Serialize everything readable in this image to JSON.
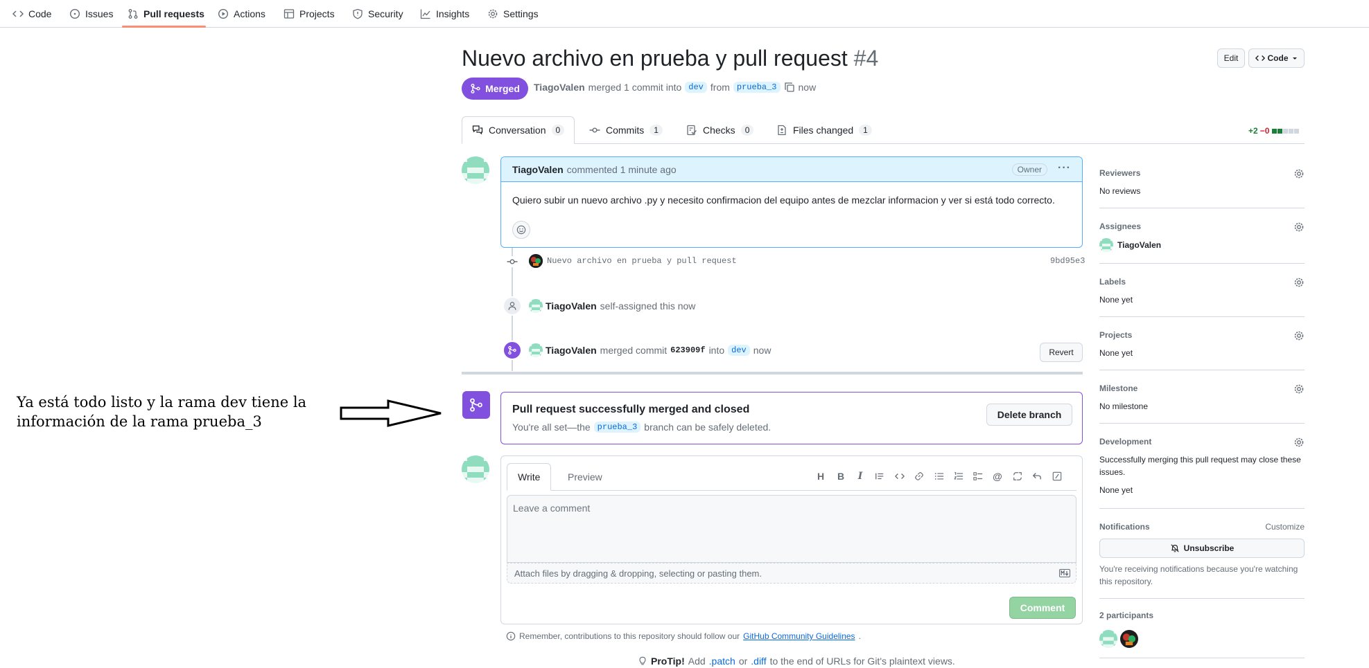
{
  "nav": {
    "items": [
      {
        "label": "Code",
        "icon": "code-icon"
      },
      {
        "label": "Issues",
        "icon": "issue-icon"
      },
      {
        "label": "Pull requests",
        "icon": "pull-request-icon"
      },
      {
        "label": "Actions",
        "icon": "play-icon"
      },
      {
        "label": "Projects",
        "icon": "table-icon"
      },
      {
        "label": "Security",
        "icon": "shield-icon"
      },
      {
        "label": "Insights",
        "icon": "graph-icon"
      },
      {
        "label": "Settings",
        "icon": "gear-icon"
      }
    ],
    "active": "Pull requests"
  },
  "pr": {
    "title": "Nuevo archivo en prueba y pull request",
    "number": "#4",
    "status": "Merged",
    "author": "TiagoValen",
    "merged_text": "merged 1 commit into",
    "base_branch": "dev",
    "from_text": "from",
    "head_branch": "prueba_3",
    "time": "now",
    "edit_label": "Edit",
    "code_label": "Code"
  },
  "tabs": [
    {
      "label": "Conversation",
      "count": "0"
    },
    {
      "label": "Commits",
      "count": "1"
    },
    {
      "label": "Checks",
      "count": "0"
    },
    {
      "label": "Files changed",
      "count": "1"
    }
  ],
  "diffstat": {
    "added": "+2",
    "removed": "−0",
    "colors": [
      "#1a7f37",
      "#1a7f37",
      "#d0d7de",
      "#d0d7de",
      "#d0d7de"
    ]
  },
  "comment": {
    "author": "TiagoValen",
    "action": "commented 1 minute ago",
    "role": "Owner",
    "body": "Quiero subir un nuevo archivo .py y necesito confirmacion del equipo antes de mezclar informacion y ver si está todo correcto."
  },
  "timeline": {
    "commit_message": "Nuevo archivo en prueba y pull request",
    "commit_sha": "9bd95e3",
    "assign_user": "TiagoValen",
    "assign_text": "self-assigned this now",
    "merge_user": "TiagoValen",
    "merge_text": "merged commit",
    "merge_sha": "623909f",
    "merge_into": "into",
    "merge_branch": "dev",
    "merge_time": "now",
    "revert_label": "Revert"
  },
  "merged_box": {
    "title": "Pull request successfully merged and closed",
    "sub_prefix": "You're all set—the",
    "branch": "prueba_3",
    "sub_suffix": "branch can be safely deleted.",
    "delete_label": "Delete branch"
  },
  "editor": {
    "write_tab": "Write",
    "preview_tab": "Preview",
    "placeholder": "Leave a comment",
    "attach_text": "Attach files by dragging & dropping, selecting or pasting them.",
    "submit_label": "Comment"
  },
  "footer": {
    "note_prefix": "Remember, contributions to this repository should follow our",
    "note_link": "GitHub Community Guidelines",
    "note_suffix": ".",
    "protip_label": "ProTip!",
    "protip_a": "Add",
    "protip_patch": ".patch",
    "protip_or": "or",
    "protip_diff": ".diff",
    "protip_b": "to the end of URLs for Git's plaintext views."
  },
  "sidebar": {
    "reviewers": {
      "title": "Reviewers",
      "value": "No reviews"
    },
    "assignees": {
      "title": "Assignees",
      "value": "TiagoValen"
    },
    "labels": {
      "title": "Labels",
      "value": "None yet"
    },
    "projects": {
      "title": "Projects",
      "value": "None yet"
    },
    "milestone": {
      "title": "Milestone",
      "value": "No milestone"
    },
    "development": {
      "title": "Development",
      "desc": "Successfully merging this pull request may close these issues.",
      "value": "None yet"
    },
    "notifications": {
      "title": "Notifications",
      "customize": "Customize",
      "unsubscribe": "Unsubscribe",
      "desc": "You're receiving notifications because you're watching this repository."
    },
    "participants": {
      "title": "2 participants"
    }
  },
  "annotation": {
    "text": "Ya está todo listo y la rama dev tiene la información de la rama prueba_3"
  }
}
